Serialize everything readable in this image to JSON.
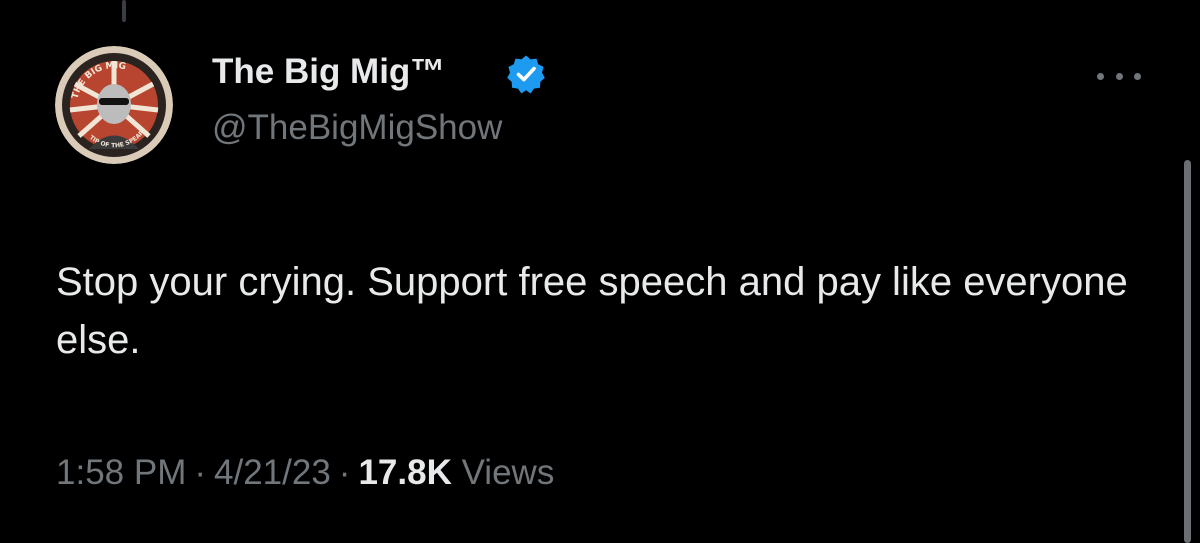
{
  "author": {
    "display_name": "The Big Mig™",
    "handle": "@TheBigMigShow",
    "verified_icon": "verified-badge-icon",
    "verified_color": "#1d9bf0",
    "avatar": {
      "arc_top": "THE BIG MIG",
      "arc_bottom": "TIP OF THE SPEAR"
    }
  },
  "tweet": {
    "text": "Stop your crying. Support free speech and pay like everyone else."
  },
  "meta": {
    "time": "1:58 PM",
    "separator": "·",
    "date": "4/21/23",
    "views_count": "17.8K",
    "views_label": "Views"
  },
  "more_icon": "more-options-icon",
  "colors": {
    "background": "#000000",
    "primary_text": "#e7e9ea",
    "secondary_text": "#71767b",
    "accent": "#1d9bf0"
  }
}
